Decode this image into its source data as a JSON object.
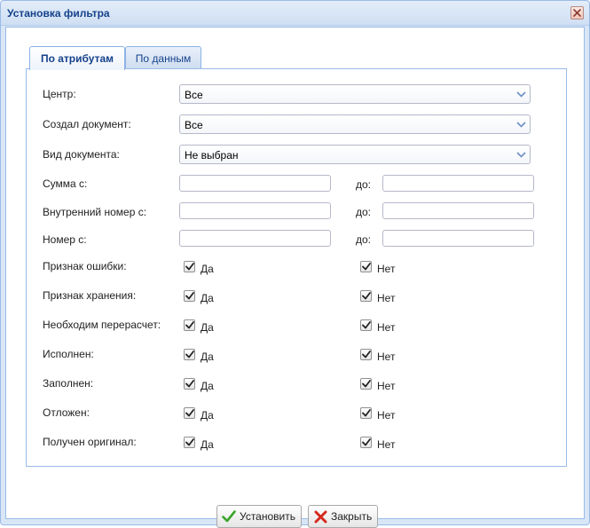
{
  "window": {
    "title": "Установка фильтра"
  },
  "tabs": [
    {
      "label": "По атрибутам",
      "active": true
    },
    {
      "label": "По данным",
      "active": false
    }
  ],
  "combos": [
    {
      "label": "Центр:",
      "value": "Все"
    },
    {
      "label": "Создал документ:",
      "value": "Все"
    },
    {
      "label": "Вид документа:",
      "value": "Не выбран"
    }
  ],
  "ranges": [
    {
      "label": "Сумма с:",
      "to_label": "до:",
      "from_value": "",
      "to_value": ""
    },
    {
      "label": "Внутренний номер с:",
      "to_label": "до:",
      "from_value": "",
      "to_value": ""
    },
    {
      "label": "Номер с:",
      "to_label": "до:",
      "from_value": "",
      "to_value": ""
    }
  ],
  "checks": [
    {
      "label": "Признак ошибки:",
      "yes": "Да",
      "no": "Нет",
      "yes_checked": true,
      "no_checked": true
    },
    {
      "label": "Признак хранения:",
      "yes": "Да",
      "no": "Нет",
      "yes_checked": true,
      "no_checked": true
    },
    {
      "label": "Необходим перерасчет:",
      "yes": "Да",
      "no": "Нет",
      "yes_checked": true,
      "no_checked": true
    },
    {
      "label": "Исполнен:",
      "yes": "Да",
      "no": "Нет",
      "yes_checked": true,
      "no_checked": true
    },
    {
      "label": "Заполнен:",
      "yes": "Да",
      "no": "Нет",
      "yes_checked": true,
      "no_checked": true
    },
    {
      "label": "Отложен:",
      "yes": "Да",
      "no": "Нет",
      "yes_checked": true,
      "no_checked": true
    },
    {
      "label": "Получен оригинал:",
      "yes": "Да",
      "no": "Нет",
      "yes_checked": true,
      "no_checked": true
    }
  ],
  "buttons": {
    "apply": "Установить",
    "close": "Закрыть"
  },
  "icons": {
    "window_close": "close-icon",
    "combo_trigger": "chevron-down-icon",
    "apply": "checkmark-icon",
    "close": "red-x-icon"
  },
  "colors": {
    "title_text": "#15428b",
    "border": "#99bbe8",
    "apply_icon": "#3aa52a",
    "close_icon": "#d42a1e"
  }
}
